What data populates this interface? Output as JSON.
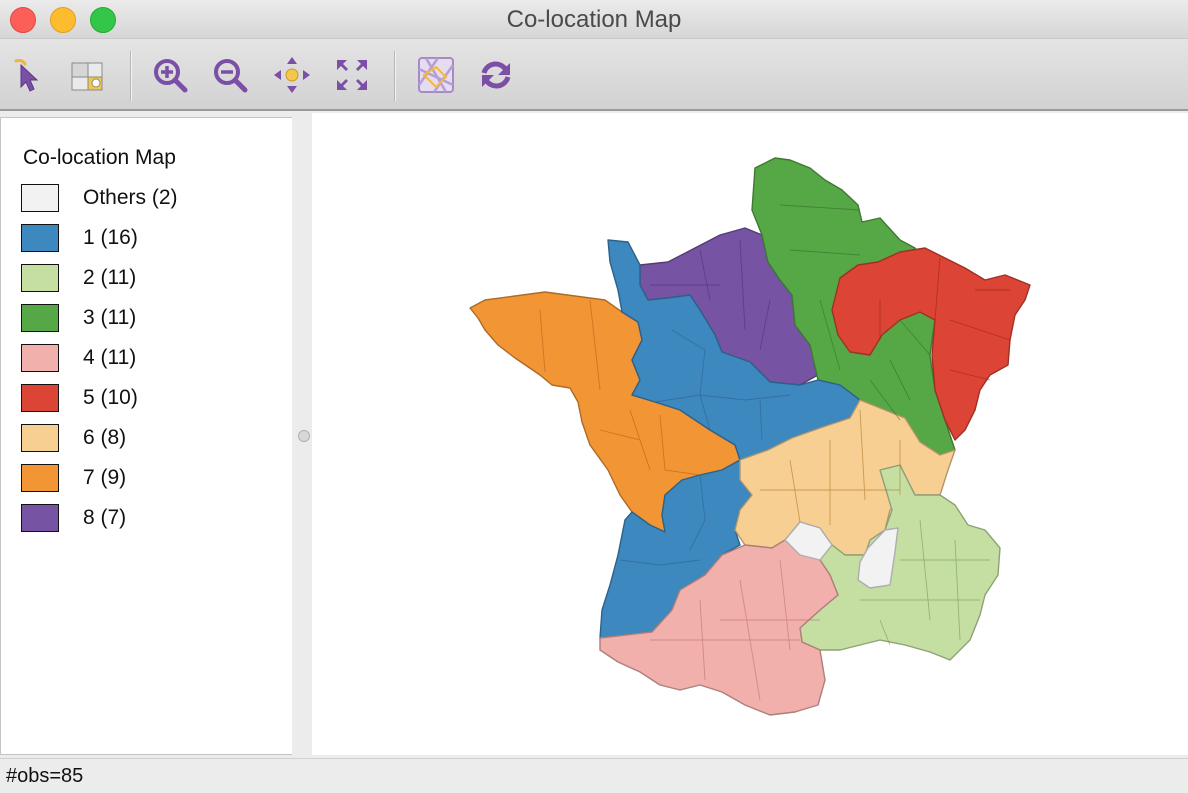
{
  "window": {
    "title": "Co-location Map"
  },
  "toolbar": {
    "buttons": [
      {
        "name": "select-tool",
        "icon": "pointer-icon"
      },
      {
        "name": "selection-tool",
        "icon": "select-shapes-icon"
      },
      {
        "name": "zoom-in",
        "icon": "zoom-in-icon"
      },
      {
        "name": "zoom-out",
        "icon": "zoom-out-icon"
      },
      {
        "name": "pan",
        "icon": "pan-icon"
      },
      {
        "name": "fit-to-window",
        "icon": "fit-extent-icon"
      },
      {
        "name": "basemap",
        "icon": "basemap-icon"
      },
      {
        "name": "refresh",
        "icon": "refresh-icon"
      }
    ]
  },
  "legend": {
    "title": "Co-location Map",
    "items": [
      {
        "label": "Others (2)",
        "color": "#f2f2f2"
      },
      {
        "label": "1 (16)",
        "color": "#3d88bf"
      },
      {
        "label": "2 (11)",
        "color": "#c5dfa3"
      },
      {
        "label": "3 (11)",
        "color": "#56a846"
      },
      {
        "label": "4 (11)",
        "color": "#f1b0ab"
      },
      {
        "label": "5 (10)",
        "color": "#dc4435"
      },
      {
        "label": "6 (8)",
        "color": "#f7cf93"
      },
      {
        "label": "7 (9)",
        "color": "#f29535"
      },
      {
        "label": "8 (7)",
        "color": "#7653a3"
      }
    ]
  },
  "status": {
    "text": "#obs=85"
  }
}
